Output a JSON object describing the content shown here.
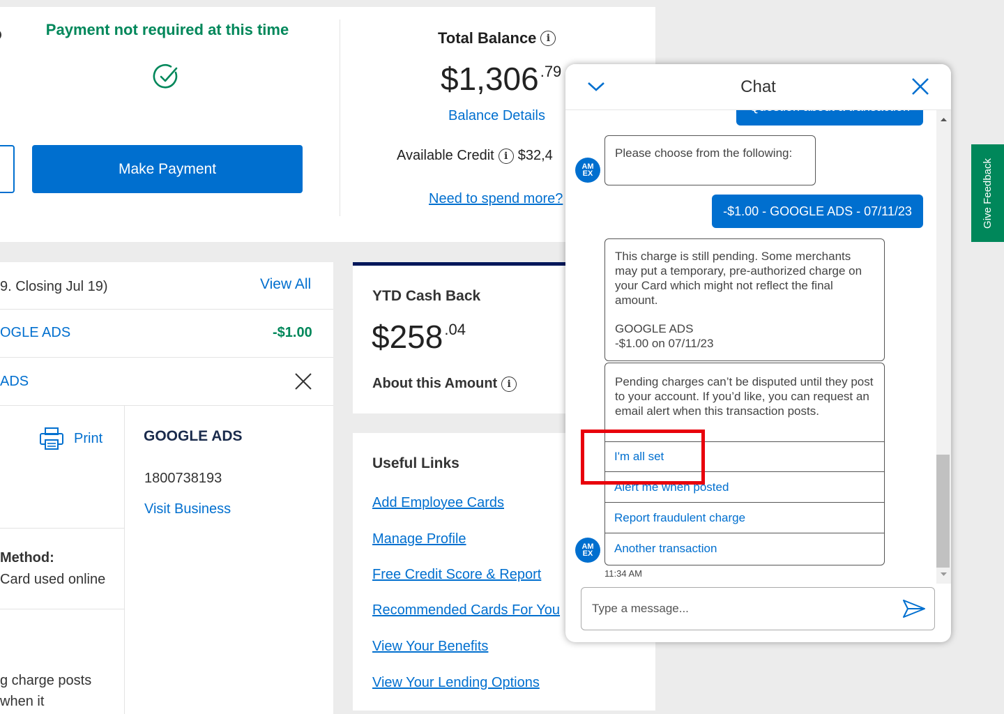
{
  "summary": {
    "payment_status": "Payment not required at this time",
    "make_payment_label": "Make Payment",
    "total_balance_label": "Total Balance",
    "total_balance_dollars": "$1,306",
    "total_balance_cents": ".79",
    "balance_details_label": "Balance Details",
    "available_credit_label": "Available Credit",
    "available_credit_value": "$32,4",
    "need_to_spend_label": "Need to spend more?"
  },
  "activity": {
    "closing_text": "9. Closing Jul 19)",
    "view_all_label": "View All",
    "txn1_name": "OGLE ADS",
    "txn1_amount": "-$1.00",
    "txn2_name": "ADS",
    "print_label": "Print",
    "merchant_name": "GOOGLE ADS",
    "merchant_phone": "1800738193",
    "visit_business_label": "Visit Business",
    "method_label": "Method:",
    "method_value": "Card used online",
    "pending_note_line1": "g charge posts",
    "pending_note_line2": "when it"
  },
  "ytd": {
    "title": "YTD Cash Back",
    "amount_dollars": "$258",
    "amount_cents": ".04",
    "about_label": "About this Amount"
  },
  "useful_links": {
    "title": "Useful Links",
    "items": [
      "Add Employee Cards",
      "Manage Profile",
      "Free Credit Score & Report",
      "Recommended Cards For You",
      "View Your Benefits",
      "View Your Lending Options"
    ]
  },
  "feedback_label": "Give Feedback",
  "chat": {
    "title": "Chat",
    "prev_option_partial": "Question about a transaction",
    "bot_prompt": "Please choose from the following:",
    "user_selection": "-$1.00 - GOOGLE ADS - 07/11/23",
    "pending_message": "This charge is still pending. Some merchants may put a temporary, pre-authorized charge on your Card which might not reflect the final amount.",
    "merchant_line": "GOOGLE ADS",
    "amount_line": "-$1.00 on 07/11/23",
    "dispute_message": "Pending charges can’t be disputed until they post to your account. If you’d like, you can request an email alert when this transaction posts.",
    "options": [
      "I'm all set",
      "Alert me when posted",
      "Report fraudulent charge",
      "Another transaction"
    ],
    "timestamp": "11:34 AM",
    "input_placeholder": "Type a message...",
    "logo_text_top": "AM",
    "logo_text_bottom": "EX"
  },
  "colors": {
    "brand_blue": "#006fcf",
    "success_green": "#00875a",
    "highlight_red": "#e8000c",
    "navy": "#00175a"
  }
}
